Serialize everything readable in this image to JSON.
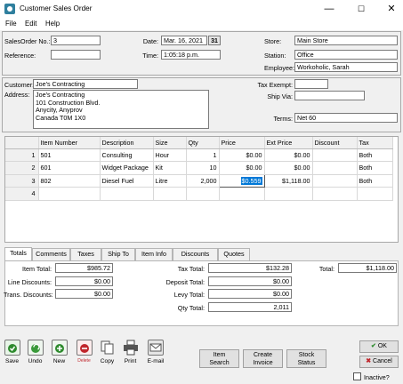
{
  "window": {
    "title": "Customer Sales Order",
    "minimize": "—",
    "maximize": "☐",
    "close": "✕"
  },
  "menu": [
    "File",
    "Edit",
    "Help"
  ],
  "header": {
    "salesorder_label": "SalesOrder No.:",
    "salesorder_value": "3",
    "reference_label": "Reference:",
    "reference_value": "",
    "date_label": "Date:",
    "date_value": "Mar. 16, 2021",
    "time_label": "Time:",
    "time_value": "1:05:18 p.m.",
    "store_label": "Store:",
    "store_value": "Main Store",
    "station_label": "Station:",
    "station_value": "Office",
    "employee_label": "Employee:",
    "employee_value": "Workoholic, Sarah",
    "calendar_glyph": "31"
  },
  "customer": {
    "customer_label": "Customer:",
    "customer_value": "Joe's Contracting",
    "address_label": "Address:",
    "address_lines": [
      "Joe's Contracting",
      "101 Construction Blvd.",
      "Anycity, Anyprov",
      "Canada  T0M 1X0"
    ],
    "tax_exempt_label": "Tax Exempt:",
    "tax_exempt_value": "",
    "ship_via_label": "Ship Via:",
    "ship_via_value": "",
    "terms_label": "Terms:",
    "terms_value": "Net 60"
  },
  "grid": {
    "columns": [
      "",
      "Item Number",
      "Description",
      "Size",
      "Qty",
      "Price",
      "Ext Price",
      "Discount",
      "Tax"
    ],
    "rows": [
      [
        "1",
        "501",
        "Consulting",
        "Hour",
        "1",
        "$0.00",
        "$0.00",
        "",
        "Both"
      ],
      [
        "2",
        "601",
        "Widget Package",
        "Kit",
        "10",
        "$0.00",
        "$0.00",
        "",
        "Both"
      ],
      [
        "3",
        "802",
        "Diesel Fuel",
        "Litre",
        "2,000",
        "$0.559",
        "$1,118.00",
        "",
        "Both"
      ],
      [
        "4",
        "",
        "",
        "",
        "",
        "",
        "",
        "",
        ""
      ]
    ]
  },
  "tabs": [
    "Totals",
    "Comments",
    "Taxes",
    "Ship To",
    "Item Info",
    "Discounts",
    "Quotes"
  ],
  "totals": {
    "item_total_label": "Item Total:",
    "item_total": "$985.72",
    "line_discounts_label": "Line Discounts:",
    "line_discounts": "$0.00",
    "trans_discounts_label": "Trans. Discounts:",
    "trans_discounts": "$0.00",
    "tax_total_label": "Tax Total:",
    "tax_total": "$132.28",
    "deposit_total_label": "Deposit Total:",
    "deposit_total": "$0.00",
    "levy_total_label": "Levy Total:",
    "levy_total": "$0.00",
    "qty_total_label": "Qty Total:",
    "qty_total": "2,011",
    "total_label": "Total:",
    "total": "$1,118.00"
  },
  "toolbar": {
    "save": "Save",
    "undo": "Undo",
    "new": "New",
    "delete": "Delete",
    "copy": "Copy",
    "print": "Print",
    "email": "E-mail"
  },
  "actions": {
    "item_search_1": "Item",
    "item_search_2": "Search",
    "create_invoice_1": "Create",
    "create_invoice_2": "Invoice",
    "stock_status_1": "Stock",
    "stock_status_2": "Status",
    "ok": "OK",
    "cancel": "Cancel",
    "inactive": "Inactive?"
  },
  "colors": {
    "accent_select": "#0078d7",
    "save_green": "#2e8b2e",
    "delete_red": "#c0262c"
  }
}
